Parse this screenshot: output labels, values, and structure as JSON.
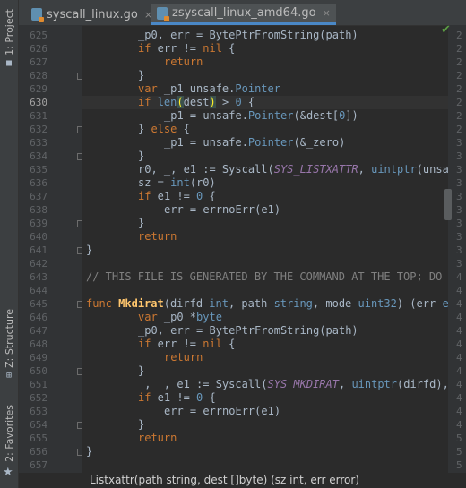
{
  "colors": {
    "keyword": "#cc7832",
    "type": "#6897bb",
    "constant": "#9876aa",
    "comment": "#808080",
    "func_name": "#ffc66d",
    "text": "#a9b7c6",
    "accent": "#4a88c7"
  },
  "left_toolbar": {
    "project": "1: Project",
    "structure": "Z: Structure",
    "favorites": "2: Favorites",
    "project_icon": "folder-icon",
    "structure_icon": "structure-icon",
    "favorites_icon": "star-icon"
  },
  "tabs": [
    {
      "label": "syscall_linux.go",
      "close": "×",
      "icon": "go-file-icon",
      "active": false
    },
    {
      "label": "zsyscall_linux_amd64.go",
      "close": "×",
      "icon": "go-file-icon",
      "active": true
    }
  ],
  "inspection_icon": "checkmark-icon",
  "line_numbers": [
    "625",
    "626",
    "627",
    "628",
    "629",
    "630",
    "631",
    "632",
    "633",
    "634",
    "635",
    "636",
    "637",
    "638",
    "639",
    "640",
    "641",
    "642",
    "643",
    "644",
    "645",
    "646",
    "647",
    "648",
    "649",
    "650",
    "651",
    "652",
    "653",
    "654",
    "655",
    "656",
    "657"
  ],
  "current_line": "630",
  "code_lines": [
    {
      "indent": 2,
      "segments": [
        {
          "t": "_p0, err = BytePtrFromString(path)"
        }
      ]
    },
    {
      "indent": 2,
      "segments": [
        {
          "t": "if",
          "c": "keyword"
        },
        {
          "t": " err != "
        },
        {
          "t": "nil",
          "c": "keyword"
        },
        {
          "t": " {"
        }
      ]
    },
    {
      "indent": 3,
      "segments": [
        {
          "t": "return",
          "c": "keyword"
        }
      ]
    },
    {
      "indent": 2,
      "segments": [
        {
          "t": "}"
        }
      ]
    },
    {
      "indent": 2,
      "segments": [
        {
          "t": "var",
          "c": "keyword"
        },
        {
          "t": " _p1 unsafe."
        },
        {
          "t": "Pointer",
          "c": "type"
        }
      ]
    },
    {
      "indent": 2,
      "segments": [
        {
          "t": "if",
          "c": "keyword"
        },
        {
          "t": " "
        },
        {
          "t": "len",
          "c": "type"
        },
        {
          "t": "(",
          "c": "match"
        },
        {
          "t": "dest"
        },
        {
          "t": ")",
          "c": "match"
        },
        {
          "t": " > "
        },
        {
          "t": "0",
          "c": "type"
        },
        {
          "t": " {"
        }
      ]
    },
    {
      "indent": 3,
      "segments": [
        {
          "t": "_p1 = unsafe."
        },
        {
          "t": "Pointer",
          "c": "type"
        },
        {
          "t": "(&dest["
        },
        {
          "t": "0",
          "c": "type"
        },
        {
          "t": "])"
        }
      ]
    },
    {
      "indent": 2,
      "segments": [
        {
          "t": "} "
        },
        {
          "t": "else",
          "c": "keyword"
        },
        {
          "t": " {"
        }
      ]
    },
    {
      "indent": 3,
      "segments": [
        {
          "t": "_p1 = unsafe."
        },
        {
          "t": "Pointer",
          "c": "type"
        },
        {
          "t": "(&_zero)"
        }
      ]
    },
    {
      "indent": 2,
      "segments": [
        {
          "t": "}"
        }
      ]
    },
    {
      "indent": 2,
      "segments": [
        {
          "t": "r0, _, e1 := Syscall("
        },
        {
          "t": "SYS_LISTXATTR",
          "c": "constant"
        },
        {
          "t": ", "
        },
        {
          "t": "uintptr",
          "c": "type"
        },
        {
          "t": "(unsafe."
        },
        {
          "t": "Pointer",
          "c": "type"
        },
        {
          "t": "(_p0)), uintptr(_p1), uintptr(len(dest)))"
        }
      ]
    },
    {
      "indent": 2,
      "segments": [
        {
          "t": "sz = "
        },
        {
          "t": "int",
          "c": "type"
        },
        {
          "t": "(r0)"
        }
      ]
    },
    {
      "indent": 2,
      "segments": [
        {
          "t": "if",
          "c": "keyword"
        },
        {
          "t": " e1 != "
        },
        {
          "t": "0",
          "c": "type"
        },
        {
          "t": " {"
        }
      ]
    },
    {
      "indent": 3,
      "segments": [
        {
          "t": "err = errnoErr(e1)"
        }
      ]
    },
    {
      "indent": 2,
      "segments": [
        {
          "t": "}"
        }
      ]
    },
    {
      "indent": 2,
      "segments": [
        {
          "t": "return",
          "c": "keyword"
        }
      ]
    },
    {
      "indent": 0,
      "segments": [
        {
          "t": "}"
        }
      ]
    },
    {
      "indent": 0,
      "segments": []
    },
    {
      "indent": 0,
      "segments": [
        {
          "t": "// THIS FILE IS GENERATED BY THE COMMAND AT THE TOP; DO NOT EDIT",
          "c": "comment"
        }
      ]
    },
    {
      "indent": 0,
      "segments": []
    },
    {
      "indent": 0,
      "segments": [
        {
          "t": "func",
          "c": "keyword"
        },
        {
          "t": " "
        },
        {
          "t": "Mkdirat",
          "c": "func"
        },
        {
          "t": "(dirfd "
        },
        {
          "t": "int",
          "c": "type"
        },
        {
          "t": ", path "
        },
        {
          "t": "string",
          "c": "type"
        },
        {
          "t": ", mode "
        },
        {
          "t": "uint32",
          "c": "type"
        },
        {
          "t": ") (err "
        },
        {
          "t": "error",
          "c": "type"
        },
        {
          "t": ") {"
        }
      ]
    },
    {
      "indent": 2,
      "segments": [
        {
          "t": "var",
          "c": "keyword"
        },
        {
          "t": " _p0 *"
        },
        {
          "t": "byte",
          "c": "type"
        }
      ]
    },
    {
      "indent": 2,
      "segments": [
        {
          "t": "_p0, err = BytePtrFromString(path)"
        }
      ]
    },
    {
      "indent": 2,
      "segments": [
        {
          "t": "if",
          "c": "keyword"
        },
        {
          "t": " err != "
        },
        {
          "t": "nil",
          "c": "keyword"
        },
        {
          "t": " {"
        }
      ]
    },
    {
      "indent": 3,
      "segments": [
        {
          "t": "return",
          "c": "keyword"
        }
      ]
    },
    {
      "indent": 2,
      "segments": [
        {
          "t": "}"
        }
      ]
    },
    {
      "indent": 2,
      "segments": [
        {
          "t": "_, _, e1 := Syscall("
        },
        {
          "t": "SYS_MKDIRAT",
          "c": "constant"
        },
        {
          "t": ", "
        },
        {
          "t": "uintptr",
          "c": "type"
        },
        {
          "t": "(dirfd), "
        },
        {
          "t": "uintptr",
          "c": "type"
        },
        {
          "t": "(unsafe.Pointer(_p0)), uintptr(mode))"
        }
      ]
    },
    {
      "indent": 2,
      "segments": [
        {
          "t": "if",
          "c": "keyword"
        },
        {
          "t": " e1 != "
        },
        {
          "t": "0",
          "c": "type"
        },
        {
          "t": " {"
        }
      ]
    },
    {
      "indent": 3,
      "segments": [
        {
          "t": "err = errnoErr(e1)"
        }
      ]
    },
    {
      "indent": 2,
      "segments": [
        {
          "t": "}"
        }
      ]
    },
    {
      "indent": 2,
      "segments": [
        {
          "t": "return",
          "c": "keyword"
        }
      ]
    },
    {
      "indent": 0,
      "segments": [
        {
          "t": "}"
        }
      ]
    },
    {
      "indent": 0,
      "segments": []
    },
    {
      "indent": 0,
      "segments": [
        {
          "t": "// THIS FILE IS GENERATED BY THE COMMAND AT THE TOP; DO NOT EDIT",
          "c": "comment"
        }
      ]
    }
  ],
  "right_numbers": [
    "2",
    "2",
    "2",
    "2",
    "2",
    "2",
    "2",
    "2",
    "3",
    "3",
    "3",
    "3",
    "3",
    "3",
    "3",
    "3",
    "3",
    "3",
    "4",
    "4",
    "4",
    "4",
    "4",
    "4",
    "4",
    "4",
    "4",
    "4",
    "4",
    "4",
    "5",
    "5",
    "5"
  ],
  "status_text": "Listxattr(path string, dest []byte) (sz int, err error)"
}
